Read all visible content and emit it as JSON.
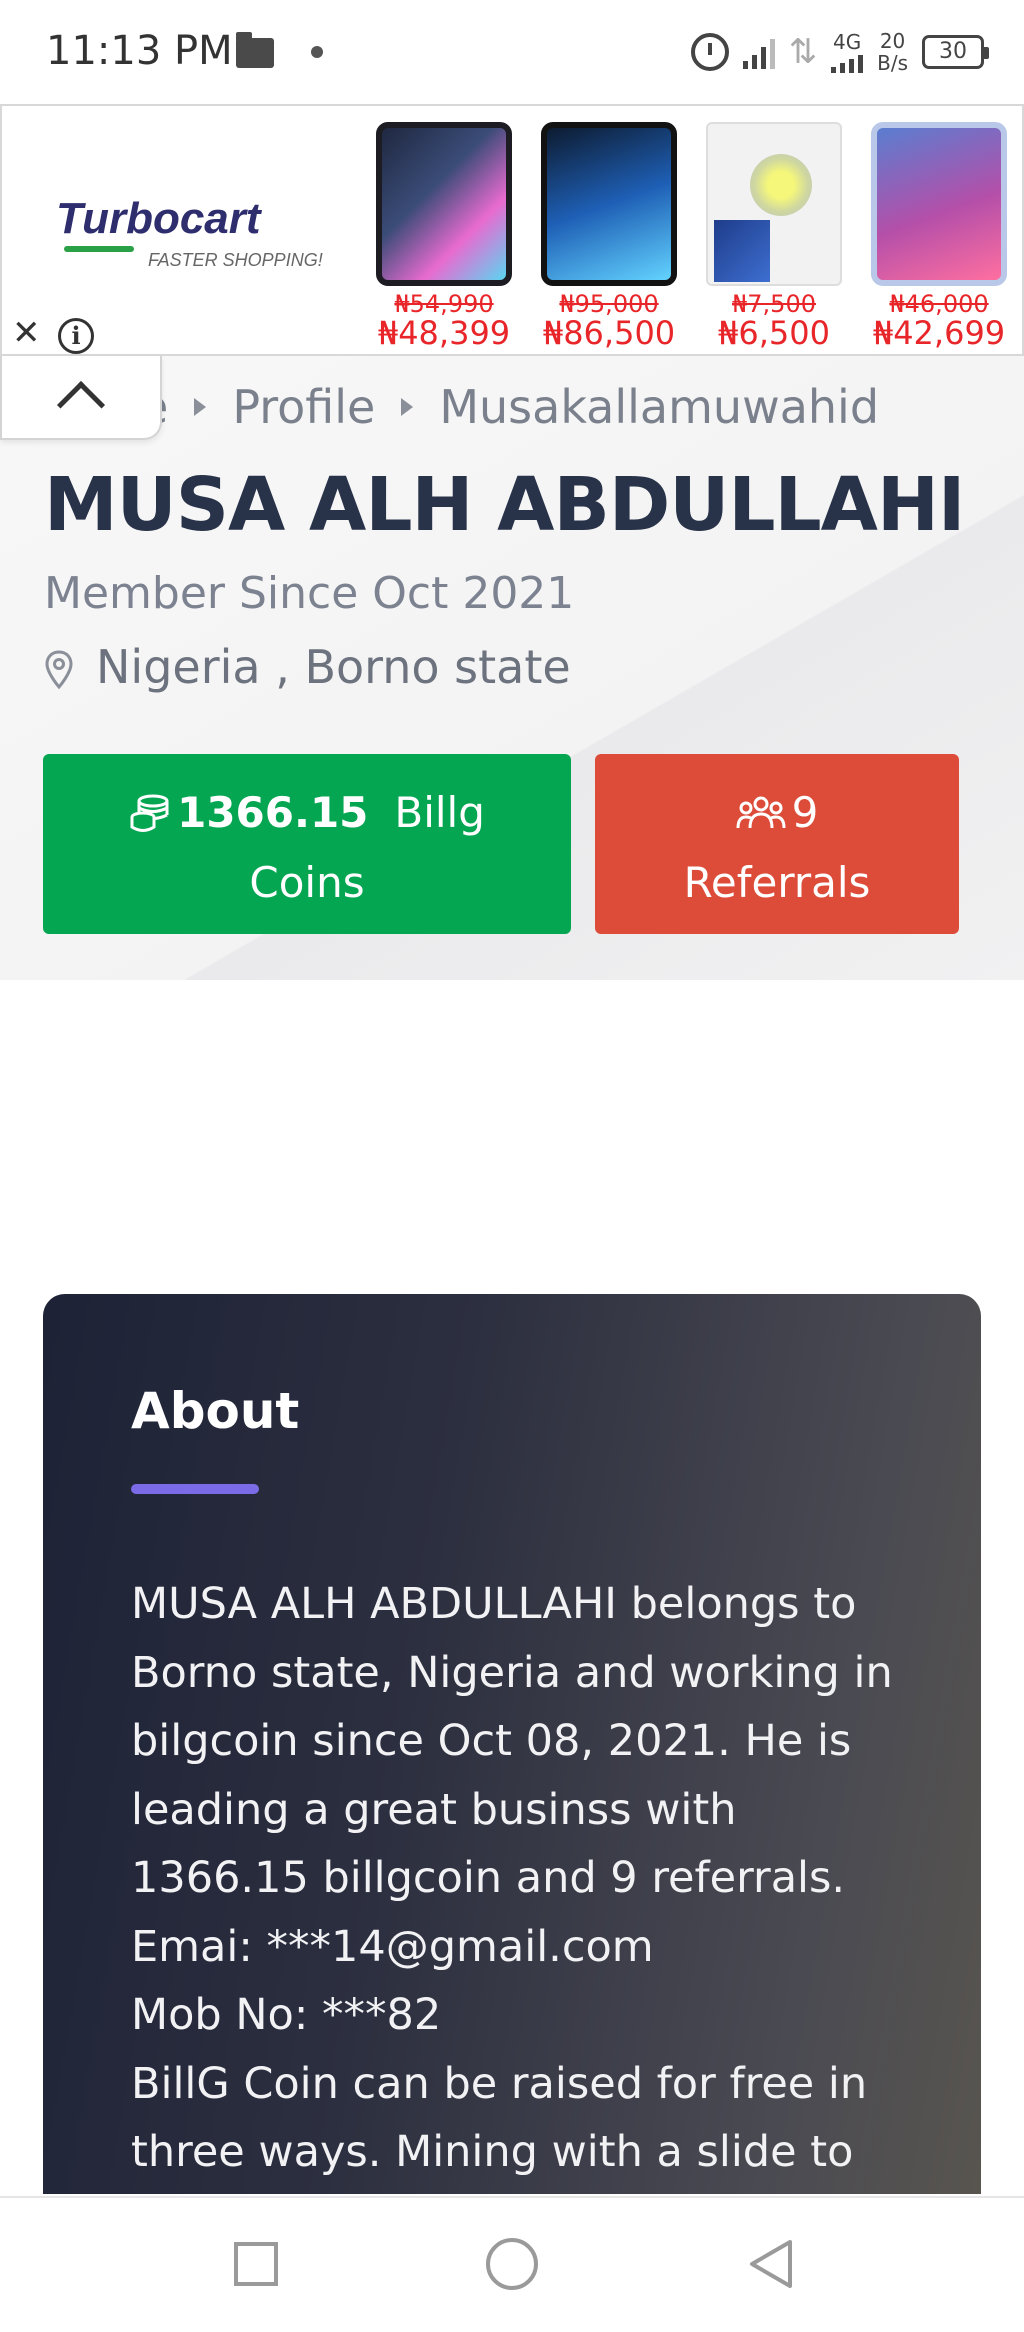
{
  "status_bar": {
    "time": "11:13 PM",
    "network": "4G",
    "speed_value": "20",
    "speed_unit": "B/s",
    "battery": "30"
  },
  "ad": {
    "brand": "Turbocart",
    "slogan": "FASTER SHOPPING!",
    "products": [
      {
        "old_price": "₦54,990",
        "new_price": "₦48,399"
      },
      {
        "old_price": "₦95,000",
        "new_price": "₦86,500"
      },
      {
        "old_price": "₦7,500",
        "new_price": "₦6,500"
      },
      {
        "old_price": "₦46,000",
        "new_price": "₦42,699"
      }
    ],
    "close_icon": "close-icon",
    "info_icon": "info-icon"
  },
  "breadcrumb": {
    "items": [
      "e",
      "Profile",
      "Musakallamuwahid"
    ]
  },
  "profile": {
    "name": "MUSA ALH ABDULLAHI",
    "member_since": "Member Since Oct 2021",
    "location": "Nigeria , Borno state"
  },
  "stats": {
    "coins_value": "1366.15",
    "coins_label_part1": "Billg",
    "coins_label_part2": "Coins",
    "referrals_value": "9",
    "referrals_label": "Referrals",
    "coins_color": "#05a652",
    "referrals_color": "#dd4b39"
  },
  "about": {
    "title": "About",
    "lines": [
      "MUSA ALH ABDULLAHI belongs to",
      "Borno state, Nigeria and working in",
      "bilgcoin since Oct 08, 2021. He is",
      "leading a great businss with",
      "1366.15 billgcoin and 9 referrals.",
      "Emai: ***14@gmail.com",
      "Mob No: ***82",
      "BillG Coin can be raised for free in",
      "three ways. Mining with a slide to"
    ],
    "accent_color": "#7b6be6"
  }
}
